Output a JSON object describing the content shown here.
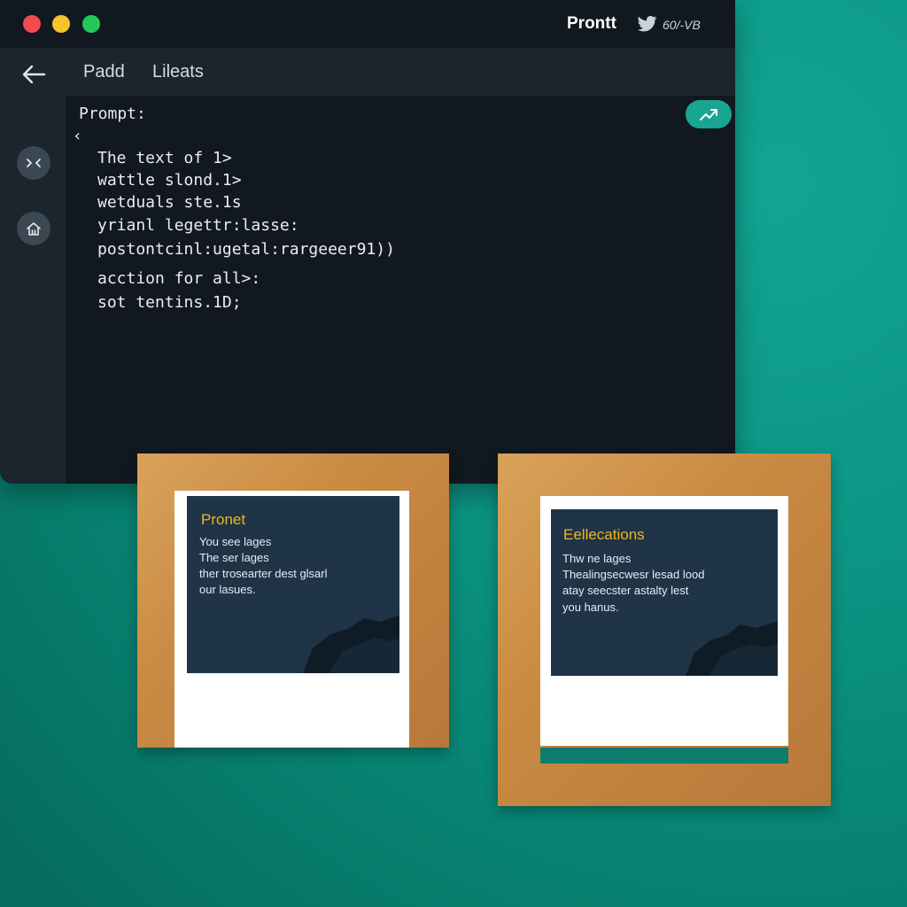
{
  "window": {
    "title": "Prontt",
    "handle": "60/-VB",
    "icons": [
      "back-icon",
      "bird-icon",
      "collapse-icon",
      "home-icon",
      "trend-icon"
    ]
  },
  "nav": {
    "items": [
      {
        "label": "Padd"
      },
      {
        "label": "Lileats"
      }
    ]
  },
  "editor": {
    "prompt_label": "Prompt:",
    "caret": "‹",
    "lines": [
      "The text of 1>",
      "wattle slond.1>",
      "wetduals ste.1s",
      "yrianl legettr:lasse:",
      "postontcinl:ugetal:rargeeer91))",
      "acction for all>:",
      "sot tentins.1D;"
    ]
  },
  "cards": [
    {
      "title": "Pronet",
      "lines": [
        "You see lages",
        "The ser lages",
        "ther trosearter dest glsarl",
        "our lasues."
      ]
    },
    {
      "title": "Eellecations",
      "lines": [
        "Thw ne lages",
        "Thealingsecwesr lesad lood",
        "atay seecster astalty lest",
        "you hanus."
      ]
    }
  ],
  "colors": {
    "accent": "#19a592",
    "card_title": "#f0b51d",
    "background": "#0c9585"
  }
}
